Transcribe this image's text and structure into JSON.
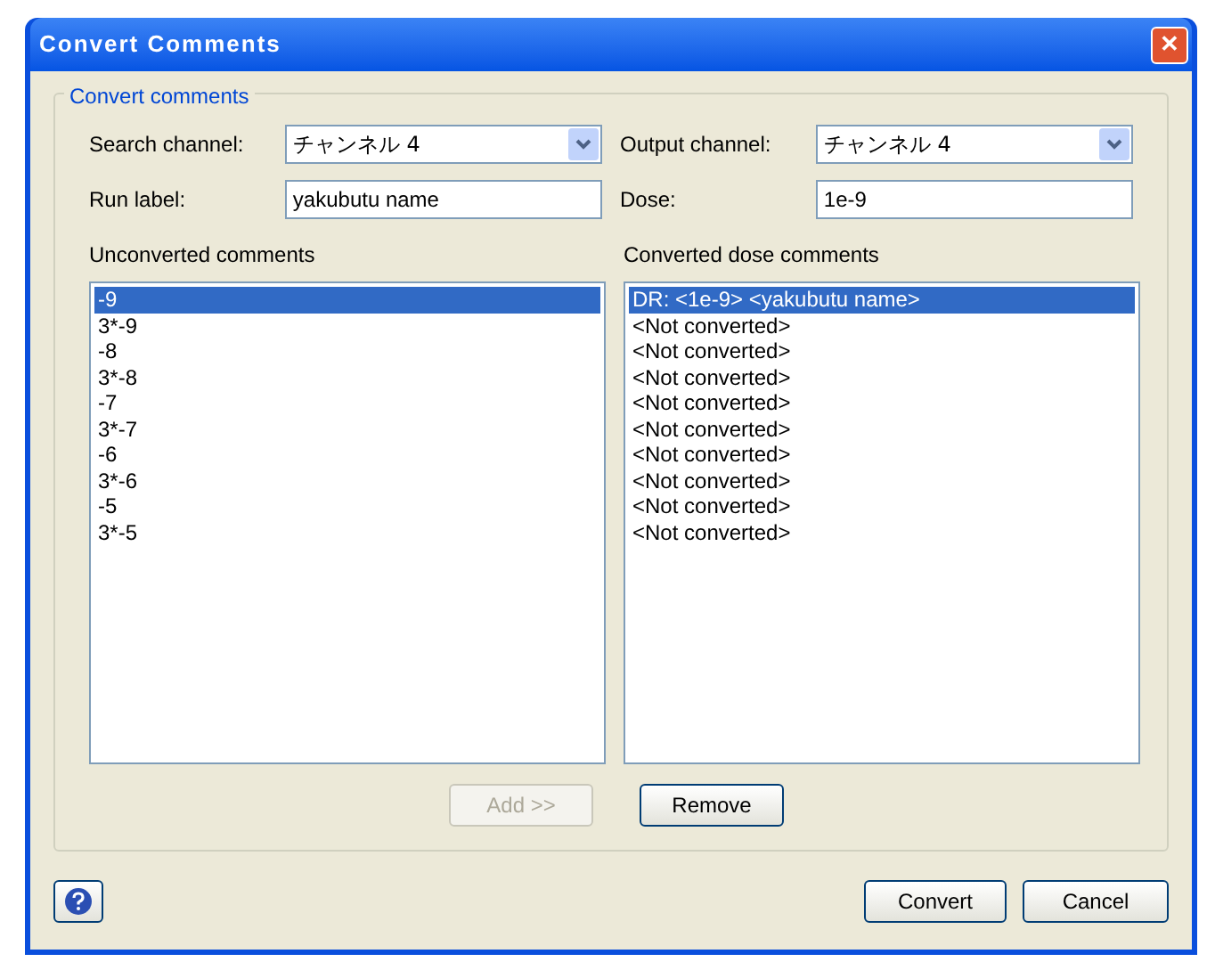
{
  "window": {
    "title": "Convert Comments",
    "close": "✕"
  },
  "group": {
    "title": "Convert comments"
  },
  "search_channel": {
    "label": "Search channel:",
    "value": "チャンネル 4"
  },
  "output_channel": {
    "label": "Output channel:",
    "value": "チャンネル 4"
  },
  "run_label": {
    "label": "Run label:",
    "value": "yakubutu name"
  },
  "dose": {
    "label": "Dose:",
    "value": "1e-9"
  },
  "unconverted": {
    "title": "Unconverted comments",
    "items": [
      {
        "text": "-9",
        "selected": true
      },
      {
        "text": "3*-9",
        "selected": false
      },
      {
        "text": "-8",
        "selected": false
      },
      {
        "text": "3*-8",
        "selected": false
      },
      {
        "text": "-7",
        "selected": false
      },
      {
        "text": "3*-7",
        "selected": false
      },
      {
        "text": "-6",
        "selected": false
      },
      {
        "text": "3*-6",
        "selected": false
      },
      {
        "text": "-5",
        "selected": false
      },
      {
        "text": "3*-5",
        "selected": false
      }
    ]
  },
  "converted": {
    "title": "Converted dose comments",
    "items": [
      {
        "text": "DR: <1e-9> <yakubutu name>",
        "selected": true
      },
      {
        "text": "<Not converted>",
        "selected": false
      },
      {
        "text": "<Not converted>",
        "selected": false
      },
      {
        "text": "<Not converted>",
        "selected": false
      },
      {
        "text": "<Not converted>",
        "selected": false
      },
      {
        "text": "<Not converted>",
        "selected": false
      },
      {
        "text": "<Not converted>",
        "selected": false
      },
      {
        "text": "<Not converted>",
        "selected": false
      },
      {
        "text": "<Not converted>",
        "selected": false
      },
      {
        "text": "<Not converted>",
        "selected": false
      }
    ]
  },
  "add_button": {
    "label": "Add >>",
    "disabled": true
  },
  "remove_button": {
    "label": "Remove",
    "disabled": false
  },
  "convert_button": {
    "label": "Convert",
    "disabled": false
  },
  "cancel_button": {
    "label": "Cancel",
    "disabled": false
  }
}
